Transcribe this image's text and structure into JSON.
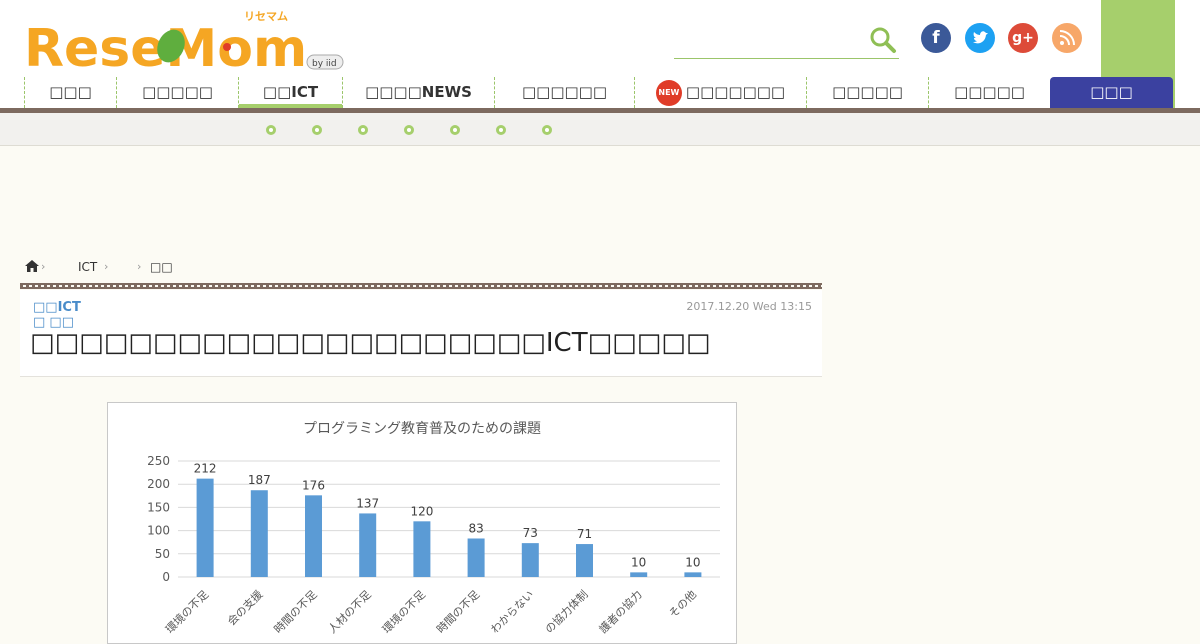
{
  "site": {
    "logo_text": "ReseMom",
    "logo_kana": "リセマム",
    "logo_by": "by iid"
  },
  "search": {
    "placeholder": ""
  },
  "social": {
    "facebook": "f",
    "twitter": "t",
    "googleplus": "g+",
    "rss": "rss"
  },
  "nav": {
    "items": [
      {
        "label": "□□□"
      },
      {
        "label": "□□□□□"
      },
      {
        "label": "□□ICT"
      },
      {
        "label": "□□□□NEWS"
      },
      {
        "label": "□□□□□□"
      },
      {
        "label": "□□□□□□□",
        "badge": "NEW"
      },
      {
        "label": "□□□□□"
      },
      {
        "label": "□□□□□"
      },
      {
        "label": "□□□"
      }
    ]
  },
  "breadcrumb": {
    "ict": "ICT",
    "last": "□□"
  },
  "article": {
    "category": "□□ICT",
    "subcategory": "□ □□",
    "date": "2017.12.20 Wed 13:15",
    "title": "□□□□□□□□□□□□□□□□□□□□□ICT□□□□□"
  },
  "chart_data": {
    "type": "bar",
    "title": "プログラミング教育普及のための課題",
    "categories": [
      "環境の不足",
      "会の支援",
      "時間の不足",
      "人材の不足",
      "環境の不足",
      "時間の不足",
      "わからない",
      "の協力体制",
      "護者の協力",
      "その他"
    ],
    "values": [
      212,
      187,
      176,
      137,
      120,
      83,
      73,
      71,
      10,
      10
    ],
    "ylim": [
      0,
      250
    ],
    "yticks": [
      0,
      50,
      100,
      150,
      200,
      250
    ],
    "grid": true,
    "colors": {
      "bar": "#5b9bd5"
    }
  }
}
